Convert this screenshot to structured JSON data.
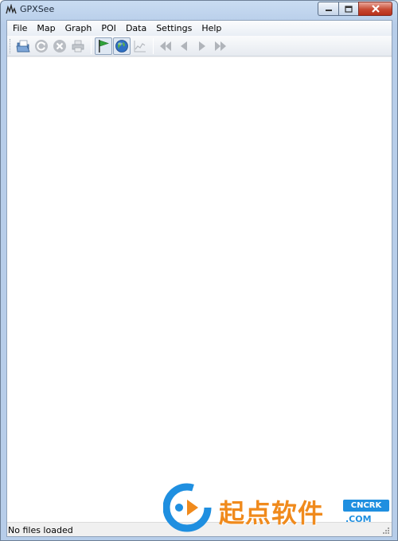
{
  "window": {
    "title": "GPXSee"
  },
  "menu": {
    "items": [
      {
        "label": "File"
      },
      {
        "label": "Map"
      },
      {
        "label": "Graph"
      },
      {
        "label": "POI"
      },
      {
        "label": "Data"
      },
      {
        "label": "Settings"
      },
      {
        "label": "Help"
      }
    ]
  },
  "toolbar": {
    "buttons": [
      {
        "icon": "open-file-icon",
        "state": "enabled"
      },
      {
        "icon": "reload-icon",
        "state": "disabled"
      },
      {
        "icon": "close-file-icon",
        "state": "disabled"
      },
      {
        "icon": "print-icon",
        "state": "disabled"
      },
      {
        "icon": "show-poi-flag-icon",
        "state": "checked"
      },
      {
        "icon": "show-map-globe-icon",
        "state": "checked"
      },
      {
        "icon": "show-graphs-icon",
        "state": "disabled"
      },
      {
        "icon": "first-file-icon",
        "state": "disabled"
      },
      {
        "icon": "previous-file-icon",
        "state": "disabled"
      },
      {
        "icon": "next-file-icon",
        "state": "disabled"
      },
      {
        "icon": "last-file-icon",
        "state": "disabled"
      }
    ]
  },
  "status": {
    "text": "No files loaded"
  },
  "watermark": {
    "text": "起点软件",
    "badge": "CNCRK",
    "sub": ".COM"
  },
  "colors": {
    "title_frame": "#b7cde9",
    "close_button": "#c74a33",
    "map_background": "#ffffff",
    "watermark_orange": "#f08a1c",
    "watermark_blue": "#1f8fe0"
  }
}
